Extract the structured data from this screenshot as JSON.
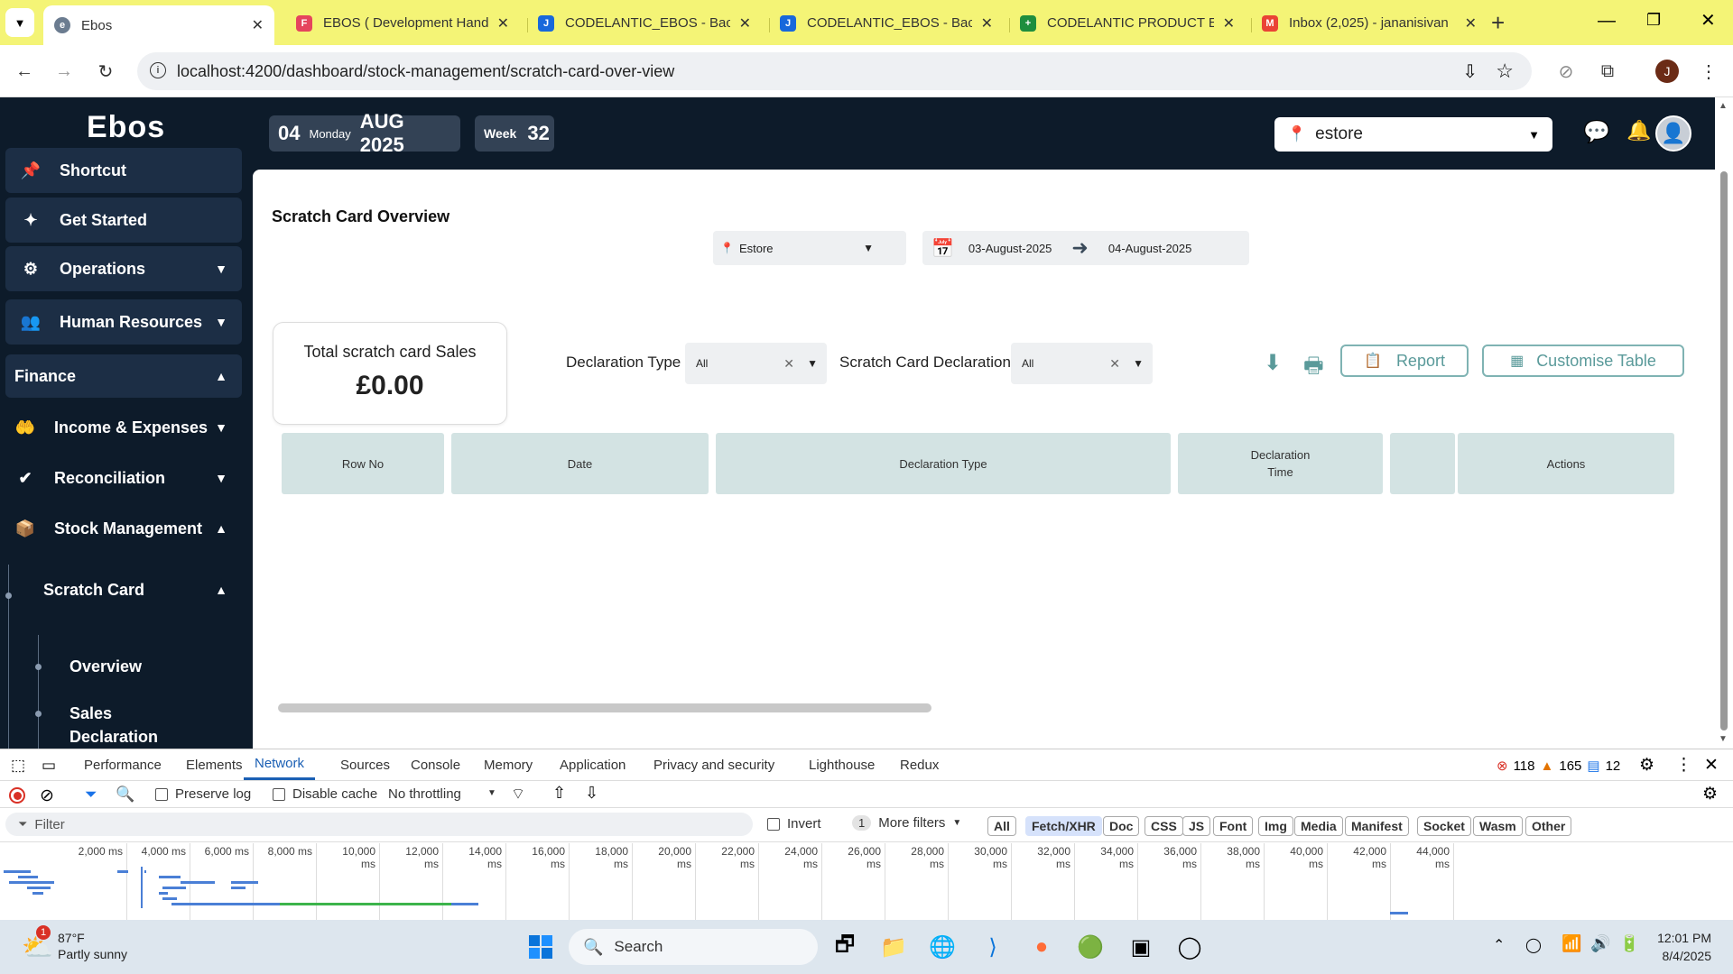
{
  "browser": {
    "tabs": [
      {
        "title": "Ebos",
        "fav_color": "#6b7c90",
        "fav_glyph": "e"
      },
      {
        "title": "EBOS ( Development Hand",
        "fav_color": "#e5445d",
        "fav_glyph": "F"
      },
      {
        "title": "CODELANTIC_EBOS - Backl",
        "fav_color": "#1868db",
        "fav_glyph": "J"
      },
      {
        "title": "CODELANTIC_EBOS - Backl",
        "fav_color": "#1868db",
        "fav_glyph": "J"
      },
      {
        "title": "CODELANTIC PRODUCT EN",
        "fav_color": "#1e8e3e",
        "fav_glyph": "+"
      },
      {
        "title": "Inbox (2,025) - jananisivan",
        "fav_color": "#ea4335",
        "fav_glyph": "M"
      }
    ],
    "url": "localhost:4200/dashboard/stock-management/scratch-card-over-view",
    "profile_initial": "J"
  },
  "app": {
    "logo": "Ebos",
    "header": {
      "day": "04",
      "weekday": "Monday",
      "month_year": "AUG 2025",
      "week_label": "Week",
      "week_num": "32",
      "store": "estore"
    },
    "sidebar": {
      "shortcut": "Shortcut",
      "get_started": "Get Started",
      "operations": "Operations",
      "human_resources": "Human Resources",
      "finance": "Finance",
      "income_expenses": "Income & Expenses",
      "reconciliation": "Reconciliation",
      "stock_management": "Stock Management",
      "scratch_card": "Scratch Card",
      "overview": "Overview",
      "sales": "Sales",
      "declaration_partial": "Declaration"
    },
    "page": {
      "title": "Scratch Card Overview",
      "store_filter": "Estore",
      "date_from": "03-August-2025",
      "date_to": "04-August-2025",
      "card_title": "Total scratch card Sales",
      "card_value": "£0.00",
      "declaration_type_label": "Declaration Type",
      "declaration_type_value": "All",
      "scratch_decl_label": "Scratch Card Declaration",
      "scratch_decl_value": "All",
      "report_btn": "Report",
      "customise_btn": "Customise Table",
      "columns": [
        "Row No",
        "Date",
        "Declaration Type",
        "Declaration\nTime",
        "",
        "Actions"
      ]
    }
  },
  "devtools": {
    "tabs": [
      "Performance",
      "Elements",
      "Network",
      "Sources",
      "Console",
      "Memory",
      "Application",
      "Privacy and security",
      "Lighthouse",
      "Redux"
    ],
    "active_tab": "Network",
    "errors": "118",
    "warnings": "165",
    "messages": "12",
    "preserve_log": "Preserve log",
    "disable_cache": "Disable cache",
    "throttling": "No throttling",
    "filter_placeholder": "Filter",
    "invert": "Invert",
    "more_filters_count": "1",
    "more_filters": "More filters",
    "type_filters": [
      "All",
      "Fetch/XHR",
      "Doc",
      "CSS",
      "JS",
      "Font",
      "Img",
      "Media",
      "Manifest",
      "Socket",
      "Wasm",
      "Other"
    ],
    "timeline_ticks": [
      "2,000 ms",
      "4,000 ms",
      "6,000 ms",
      "8,000 ms",
      "10,000 ms",
      "12,000 ms",
      "14,000 ms",
      "16,000 ms",
      "18,000 ms",
      "20,000 ms",
      "22,000 ms",
      "24,000 ms",
      "26,000 ms",
      "28,000 ms",
      "30,000 ms",
      "32,000 ms",
      "34,000 ms",
      "36,000 ms",
      "38,000 ms",
      "40,000 ms",
      "42,000 ms",
      "44,000 ms"
    ]
  },
  "taskbar": {
    "weather_temp": "87°F",
    "weather_desc": "Partly sunny",
    "weather_badge": "1",
    "search": "Search",
    "time": "12:01 PM",
    "date": "8/4/2025"
  }
}
